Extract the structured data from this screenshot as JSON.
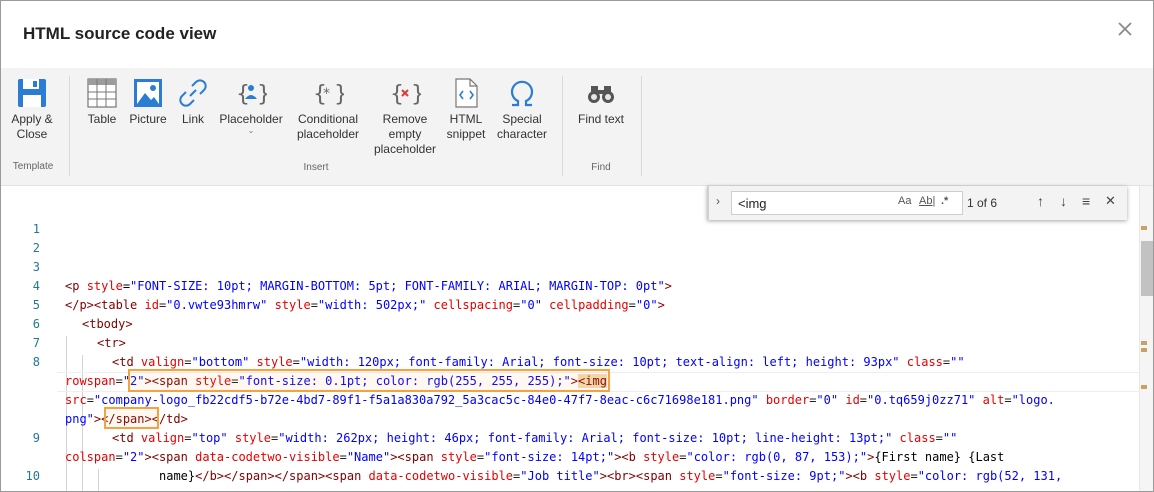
{
  "dialog": {
    "title": "HTML source code view"
  },
  "ribbon": {
    "buttons": {
      "apply": "Apply &\nClose",
      "table": "Table",
      "picture": "Picture",
      "link": "Link",
      "placeholder": "Placeholder",
      "conditional": "Conditional\nplaceholder",
      "remove": "Remove\nempty\nplaceholder",
      "snippet": "HTML\nsnippet",
      "special": "Special\ncharacter",
      "find": "Find text"
    },
    "groups": {
      "template": "Template",
      "insert": "Insert",
      "find": "Find"
    }
  },
  "find_widget": {
    "query": "<img",
    "match_case": "Aa",
    "whole_word": "Ab|",
    "regex": ".*",
    "count": "1 of 6",
    "prev": "↑",
    "next": "↓",
    "in_selection": "≡",
    "close": "✕"
  },
  "editor": {
    "line_numbers": [
      "1",
      "2",
      "3",
      "4",
      "5",
      "6",
      "7",
      "8",
      "9",
      "10"
    ],
    "lines": {
      "l4_a": "<p ",
      "l4_attr": "style",
      "l4_eq": "=",
      "l4_val": "\"FONT-SIZE: 10pt; MARGIN-BOTTOM: 5pt; FONT-FAMILY: ARIAL; MARGIN-TOP: 0pt\"",
      "l4_end": ">",
      "l5_a": "</p><table ",
      "l5_attr1": "id",
      "l5_val1": "\"0.vwte93hmrw\"",
      "l5_attr2": "style",
      "l5_val2": "\"width: 502px;\"",
      "l5_attr3": "cellspacing",
      "l5_val3": "\"0\"",
      "l5_attr4": "cellpadding",
      "l5_val4": "\"0\"",
      "l5_end": ">",
      "l6": "<tbody>",
      "l7": "<tr>",
      "l8_a": "<td ",
      "l8_attr1": "valign",
      "l8_val1": "\"bottom\"",
      "l8_attr2": "style",
      "l8_val2": "\"width: 120px; font-family: Arial; font-size: 10pt; text-align: left; height: 93px\"",
      "l8_attr3": "class",
      "l8_val3": "\"\"",
      "l8b_attr": "rowspan",
      "l8b_val": "\"2\"",
      "l8b_span": "<span ",
      "l8b_sattr": "style",
      "l8b_sval": "\"font-size: 0.1pt; color: rgb(255, 255, 255);\"",
      "l8b_img": "<img",
      "l8c_attr": "src",
      "l8c_val": "\"company-logo_fb22cdf5-b72e-4bd7-89f1-f5a1a830a792_5a3cac5c-84e0-47f7-8eac-c6c71698e181.png\"",
      "l8c_attr2": "border",
      "l8c_val2": "\"0\"",
      "l8c_attr3": "id",
      "l8c_val3": "\"0.tq659j0zz71\"",
      "l8c_attr4": "alt",
      "l8c_val4": "\"logo.",
      "l8d_val": "png\"",
      "l8d_span": "</span>",
      "l8d_td": "</td>",
      "l9_a": "<td ",
      "l9_attr1": "valign",
      "l9_val1": "\"top\"",
      "l9_attr2": "style",
      "l9_val2": "\"width: 262px; height: 46px; font-family: Arial; font-size: 10pt; line-height: 13pt;\"",
      "l9_attr3": "class",
      "l9_val3": "\"\"",
      "l9b_attr": "colspan",
      "l9b_val": "\"2\"",
      "l9b_span": "<span ",
      "l9b_sattr": "data-codetwo-visible",
      "l9b_sval": "\"Name\"",
      "l9b_span2": "<span ",
      "l9b_sattr2": "style",
      "l9b_sval2": "\"font-size: 14pt;\"",
      "l9b_b": "<b ",
      "l9b_battr": "style",
      "l9b_bval": "\"color: rgb(0, 87, 153);\"",
      "l9b_txt": "{First name} {Last",
      "l10_txt": "name}",
      "l10_tags": "</b></span></span>",
      "l10_span": "<span ",
      "l10_attr": "data-codetwo-visible",
      "l10_val": "\"Job title\"",
      "l10_br": "<br><span ",
      "l10_attr2": "style",
      "l10_val2": "\"font-size: 9pt;\"",
      "l10_b": "<b ",
      "l10_attr3": "style",
      "l10_val3": "\"color: rgb(52, 131,"
    }
  },
  "colors": {
    "accent": "#2b7cd3",
    "match_border": "#f5a340",
    "tag": "#800000",
    "attribute": "#e50000",
    "value": "#0000ff",
    "line_number": "#237893"
  }
}
